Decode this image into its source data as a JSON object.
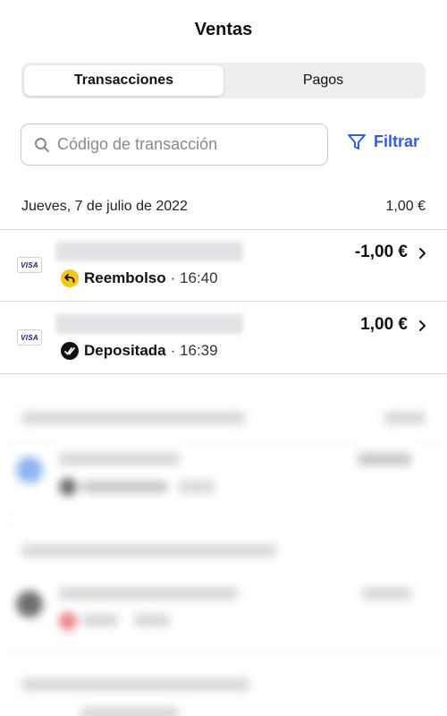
{
  "header": {
    "title": "Ventas"
  },
  "tabs": [
    {
      "label": "Transacciones",
      "active": true
    },
    {
      "label": "Pagos",
      "active": false
    }
  ],
  "search": {
    "placeholder": "Código de transacción",
    "value": ""
  },
  "filter": {
    "label": "Filtrar",
    "color": "#2f5fe0"
  },
  "group": {
    "date": "Jueves, 7 de julio de 2022",
    "total": "1,00 €"
  },
  "transactions": [
    {
      "card": "VISA",
      "status": "Reembolso",
      "time": "16:40",
      "amount": "-1,00 €",
      "status_icon": "refund-arrow-icon",
      "status_color": "#f5c518"
    },
    {
      "card": "VISA",
      "status": "Depositada",
      "time": "16:39",
      "amount": "1,00 €",
      "status_icon": "deposited-check-icon",
      "status_color": "#111111"
    }
  ]
}
